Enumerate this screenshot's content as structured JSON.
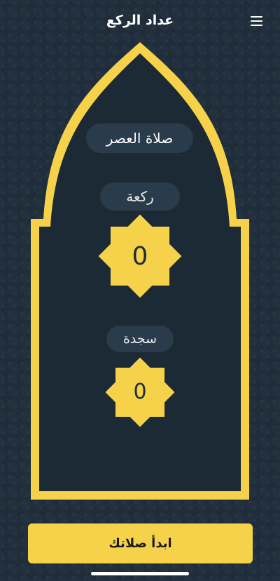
{
  "header": {
    "title": "عداد الركع",
    "menu_icon": "hamburger-menu-icon"
  },
  "prayer": {
    "name": "صلاة العصر"
  },
  "counters": {
    "rakaa": {
      "label": "ركعة",
      "value": "0"
    },
    "sajda": {
      "label": "سجدة",
      "value": "0"
    }
  },
  "start_button": {
    "label": "ابدأ صلاتك"
  },
  "colors": {
    "background": "#1f2d3a",
    "panel": "#1c2a36",
    "accent_yellow": "#f5d24a",
    "pill": "#2a3b4b"
  }
}
